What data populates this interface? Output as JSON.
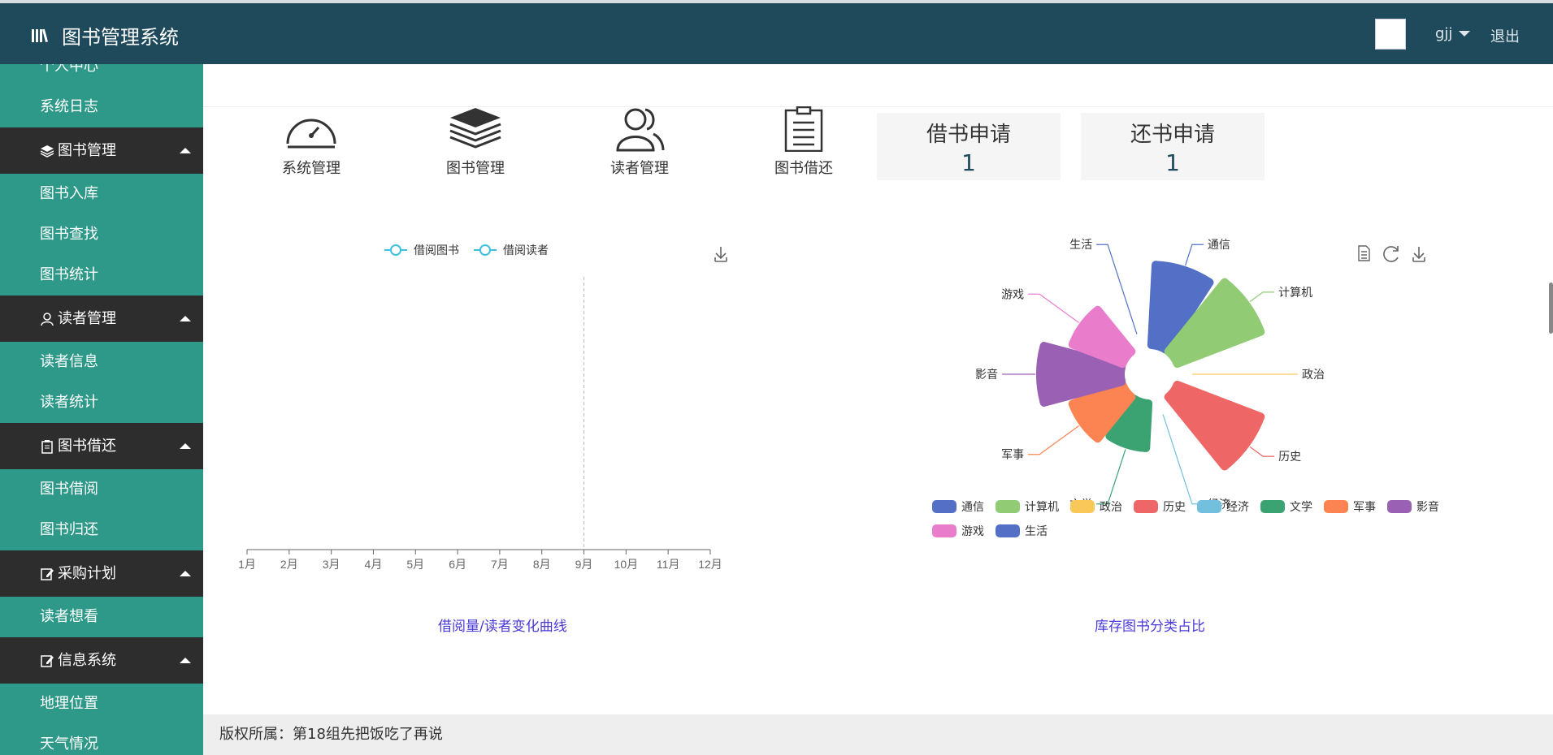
{
  "header": {
    "title": "图书管理系统",
    "user": "gjj",
    "logout": "退出"
  },
  "sidebar": {
    "items": [
      {
        "label": "个人中心",
        "type": "item"
      },
      {
        "label": "系统日志",
        "type": "item"
      },
      {
        "label": "图书管理",
        "type": "group"
      },
      {
        "label": "图书入库",
        "type": "item"
      },
      {
        "label": "图书查找",
        "type": "item"
      },
      {
        "label": "图书统计",
        "type": "item"
      },
      {
        "label": "读者管理",
        "type": "group"
      },
      {
        "label": "读者信息",
        "type": "item"
      },
      {
        "label": "读者统计",
        "type": "item"
      },
      {
        "label": "图书借还",
        "type": "group"
      },
      {
        "label": "图书借阅",
        "type": "item"
      },
      {
        "label": "图书归还",
        "type": "item"
      },
      {
        "label": "采购计划",
        "type": "group"
      },
      {
        "label": "读者想看",
        "type": "item"
      },
      {
        "label": "信息系统",
        "type": "group"
      },
      {
        "label": "地理位置",
        "type": "item"
      },
      {
        "label": "天气情况",
        "type": "item"
      }
    ]
  },
  "quick": {
    "system": "系统管理",
    "books": "图书管理",
    "readers": "读者管理",
    "borrow": "图书借还"
  },
  "cards": {
    "borrow_req": {
      "label": "借书申请",
      "value": "1"
    },
    "return_req": {
      "label": "还书申请",
      "value": "1"
    }
  },
  "footer": {
    "text": "版权所属：第18组先把饭吃了再说"
  },
  "chart_data": [
    {
      "type": "line",
      "title": "借阅量/读者变化曲线",
      "categories": [
        "1月",
        "2月",
        "3月",
        "4月",
        "5月",
        "6月",
        "7月",
        "8月",
        "9月",
        "10月",
        "11月",
        "12月"
      ],
      "series": [
        {
          "name": "借阅图书",
          "values": [],
          "color": "#3ec0e0"
        },
        {
          "name": "借阅读者",
          "values": [],
          "color": "#3ec0e0"
        }
      ],
      "legend": "top-center",
      "highlight_category": "9月"
    },
    {
      "type": "pie",
      "title": "库存图书分类占比",
      "legend": "bottom",
      "slices": [
        {
          "name": "通信",
          "value": 9,
          "color": "#5470c6"
        },
        {
          "name": "计算机",
          "value": 10,
          "color": "#91cc75"
        },
        {
          "name": "政治",
          "value": 0,
          "color": "#fac858"
        },
        {
          "name": "历史",
          "value": 10,
          "color": "#ee6666"
        },
        {
          "name": "经济",
          "value": 0,
          "color": "#73c0de"
        },
        {
          "name": "文学",
          "value": 5,
          "color": "#3ba272"
        },
        {
          "name": "军事",
          "value": 6,
          "color": "#fc8452"
        },
        {
          "name": "影音",
          "value": 9,
          "color": "#9a60b4"
        },
        {
          "name": "游戏",
          "value": 6,
          "color": "#ea7ccc"
        },
        {
          "name": "生活",
          "value": 0,
          "color": "#5470c6"
        }
      ]
    }
  ]
}
